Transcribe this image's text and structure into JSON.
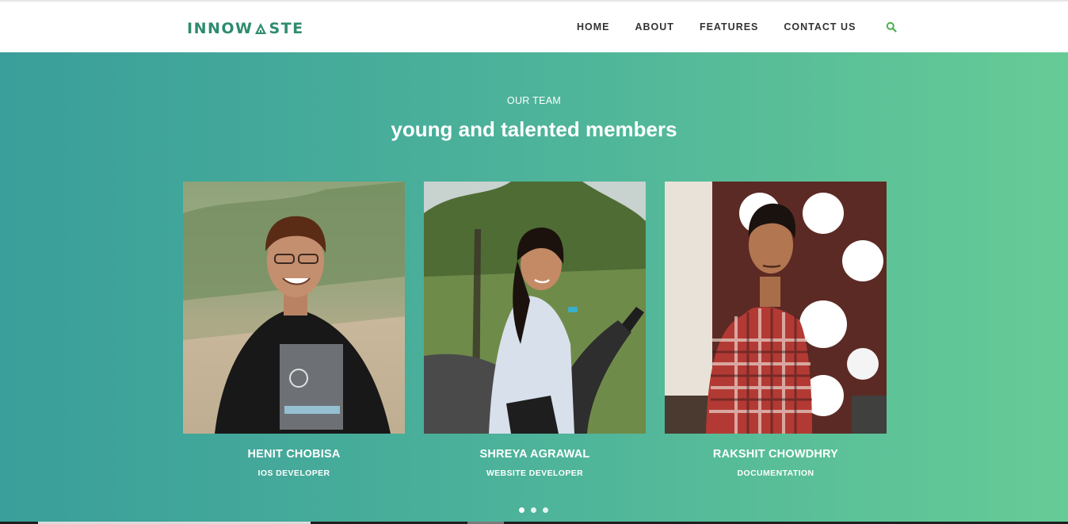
{
  "brand": {
    "name_left": "INNOW",
    "name_right": "STE",
    "color": "#2e8b6e"
  },
  "nav": {
    "items": [
      "HOME",
      "ABOUT",
      "FEATURES",
      "CONTACT US"
    ],
    "search_icon": "search-icon",
    "search_color": "#4caf50"
  },
  "team": {
    "eyebrow": "OUR TEAM",
    "headline": "young and talented members",
    "members": [
      {
        "name": "HENIT CHOBISA",
        "role": "IOS DEVELOPER"
      },
      {
        "name": "SHREYA AGRAWAL",
        "role": "WEBSITE DEVELOPER"
      },
      {
        "name": "RAKSHIT CHOWDHRY",
        "role": "DOCUMENTATION"
      }
    ],
    "carousel_pages": 3,
    "active_page": 1
  },
  "colors": {
    "gradient_start": "#3a9e9a",
    "gradient_end": "#66cb96",
    "text": "#ffffff"
  }
}
